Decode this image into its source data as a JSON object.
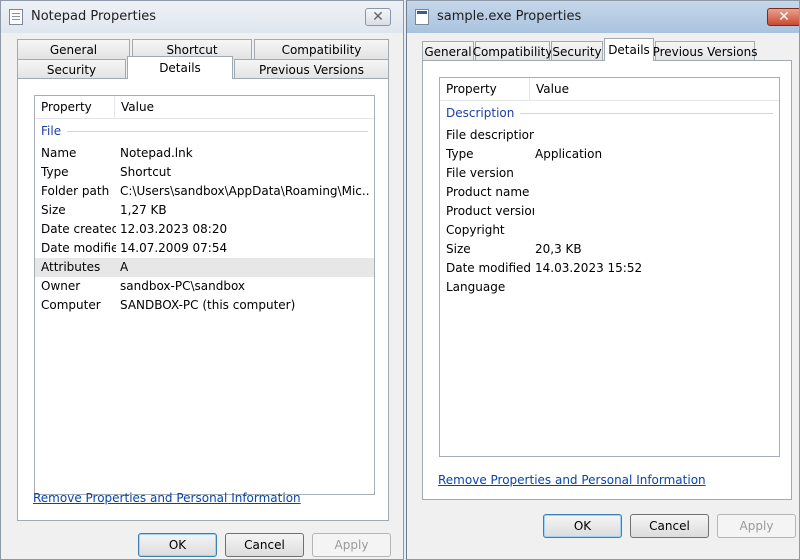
{
  "left": {
    "title": "Notepad Properties",
    "close_glyph": "✕",
    "tabs": {
      "general": "General",
      "shortcut": "Shortcut",
      "compatibility": "Compatibility",
      "security": "Security",
      "details": "Details",
      "previous_versions": "Previous Versions"
    },
    "columns": {
      "property": "Property",
      "value": "Value"
    },
    "group": "File",
    "rows": [
      {
        "p": "Name",
        "v": "Notepad.lnk"
      },
      {
        "p": "Type",
        "v": "Shortcut"
      },
      {
        "p": "Folder path",
        "v": "C:\\Users\\sandbox\\AppData\\Roaming\\Mic..."
      },
      {
        "p": "Size",
        "v": "1,27 KB"
      },
      {
        "p": "Date created",
        "v": "12.03.2023 08:20"
      },
      {
        "p": "Date modified",
        "v": "14.07.2009 07:54"
      },
      {
        "p": "Attributes",
        "v": "A"
      },
      {
        "p": "Owner",
        "v": "sandbox-PC\\sandbox"
      },
      {
        "p": "Computer",
        "v": "SANDBOX-PC (this computer)"
      }
    ],
    "link": "Remove Properties and Personal Information",
    "buttons": {
      "ok": "OK",
      "cancel": "Cancel",
      "apply": "Apply"
    }
  },
  "right": {
    "title": "sample.exe Properties",
    "close_glyph": "✕",
    "tabs": {
      "general": "General",
      "compatibility": "Compatibility",
      "security": "Security",
      "details": "Details",
      "previous_versions": "Previous Versions"
    },
    "columns": {
      "property": "Property",
      "value": "Value"
    },
    "group": "Description",
    "rows": [
      {
        "p": "File description",
        "v": ""
      },
      {
        "p": "Type",
        "v": "Application"
      },
      {
        "p": "File version",
        "v": ""
      },
      {
        "p": "Product name",
        "v": ""
      },
      {
        "p": "Product version",
        "v": ""
      },
      {
        "p": "Copyright",
        "v": ""
      },
      {
        "p": "Size",
        "v": "20,3 KB"
      },
      {
        "p": "Date modified",
        "v": "14.03.2023 15:52"
      },
      {
        "p": "Language",
        "v": ""
      }
    ],
    "link": "Remove Properties and Personal Information",
    "buttons": {
      "ok": "OK",
      "cancel": "Cancel",
      "apply": "Apply"
    }
  }
}
